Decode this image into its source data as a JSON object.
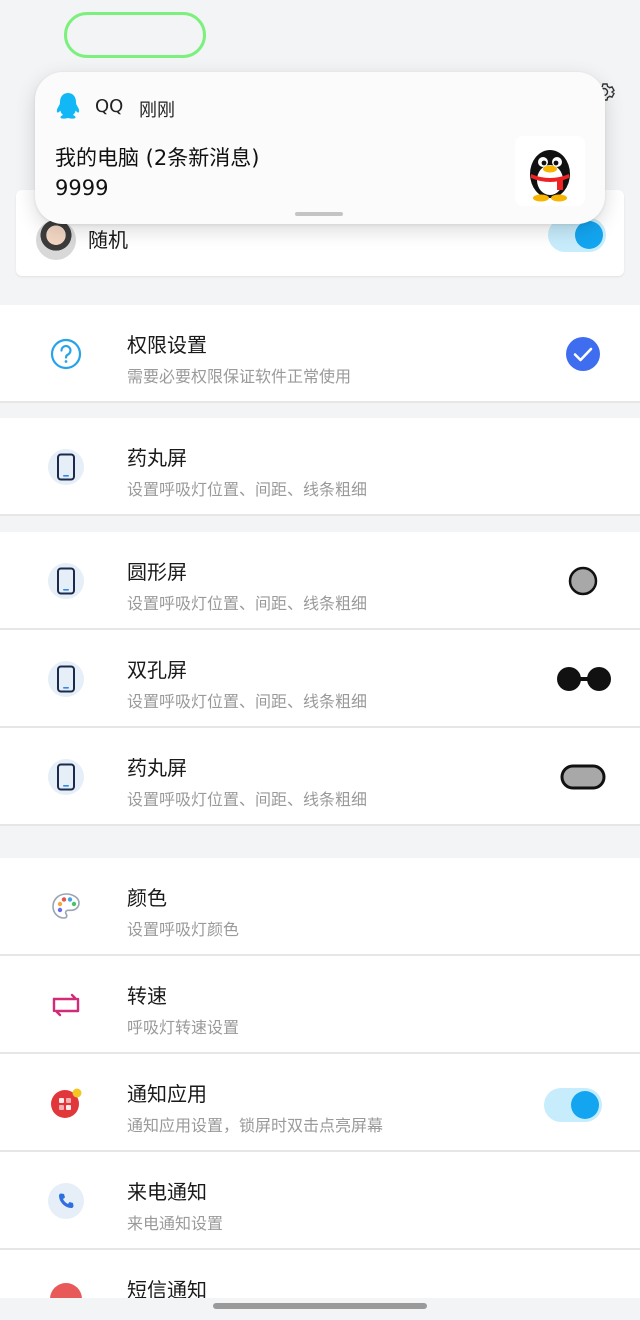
{
  "notification": {
    "app": "QQ",
    "time": "刚刚",
    "title": "我的电脑 (2条新消息)",
    "body": "9999"
  },
  "top_card": {
    "label": "随机",
    "toggle_on": true
  },
  "permission": {
    "title": "权限设置",
    "subtitle": "需要必要权限保证软件正常使用"
  },
  "pill_screen": {
    "title": "药丸屏",
    "subtitle": "设置呼吸灯位置、间距、线条粗细"
  },
  "screen_types": [
    {
      "title": "圆形屏",
      "subtitle": "设置呼吸灯位置、间距、线条粗细",
      "indicator": "circle"
    },
    {
      "title": "双孔屏",
      "subtitle": "设置呼吸灯位置、间距、线条粗细",
      "indicator": "double-hole"
    },
    {
      "title": "药丸屏",
      "subtitle": "设置呼吸灯位置、间距、线条粗细",
      "indicator": "pill"
    }
  ],
  "settings": [
    {
      "title": "颜色",
      "subtitle": "设置呼吸灯颜色",
      "icon": "palette-icon"
    },
    {
      "title": "转速",
      "subtitle": "呼吸灯转速设置",
      "icon": "rotate-icon"
    },
    {
      "title": "通知应用",
      "subtitle": "通知应用设置，锁屏时双击点亮屏幕",
      "icon": "notify-app-icon",
      "toggle_on": true
    },
    {
      "title": "来电通知",
      "subtitle": "来电通知设置",
      "icon": "phone-call-icon"
    },
    {
      "title": "短信通知",
      "subtitle": "",
      "icon": "sms-icon"
    }
  ],
  "colors": {
    "accent": "#13a5f0",
    "check": "#3f6df0",
    "toggle_track": "#c7ecfb"
  }
}
